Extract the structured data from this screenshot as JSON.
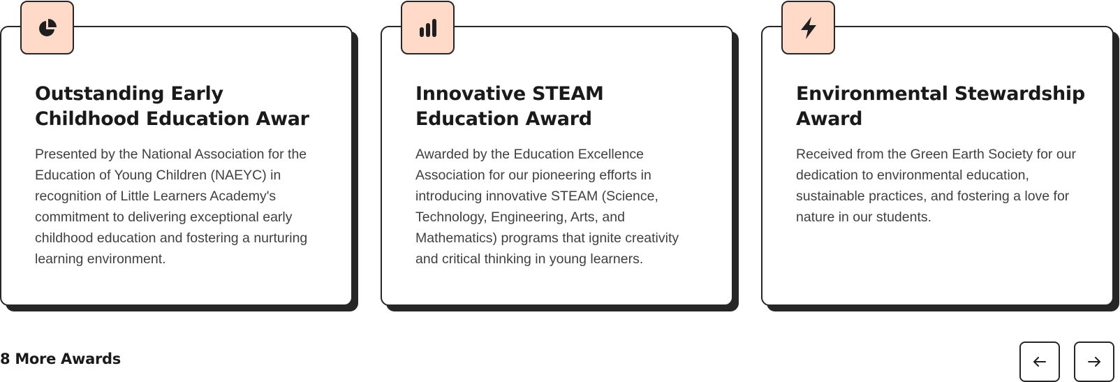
{
  "awards": [
    {
      "icon": "pie-chart-icon",
      "title": "Outstanding Early Childhood Education Awar",
      "description": "Presented by the National Association for the Education of Young Children (NAEYC) in recognition of Little Learners Academy's commitment to delivering exceptional early childhood education and fostering a nurturing learning environment."
    },
    {
      "icon": "bar-chart-icon",
      "title": "Innovative STEAM Education Award",
      "description": "Awarded by the Education Excellence Association for our pioneering efforts in introducing innovative STEAM (Science, Technology, Engineering, Arts, and Mathematics) programs that ignite creativity and critical thinking in young learners."
    },
    {
      "icon": "lightning-bolt-icon",
      "title": "Environmental Stewardship Award",
      "description": "Received from the Green Earth Society for our dedication to environmental education, sustainable practices, and fostering a love for nature in our students."
    }
  ],
  "footer": {
    "more_label": "8 More Awards",
    "prev_icon": "arrow-left-icon",
    "next_icon": "arrow-right-icon"
  },
  "colors": {
    "icon_bg": "#ffdac8",
    "border": "#262626",
    "text": "#1a1a1a",
    "body_text": "#3f3f3f"
  }
}
